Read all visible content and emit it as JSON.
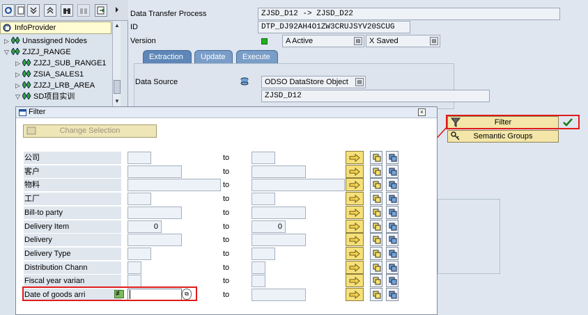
{
  "tree": {
    "header": "InfoProvider",
    "nodes": [
      {
        "label": "Unassigned Nodes",
        "level": 0,
        "expanded": false
      },
      {
        "label": "ZJZJ_RANGE",
        "level": 0,
        "expanded": true
      },
      {
        "label": "ZJZJ_SUB_RANGE1",
        "level": 1,
        "expanded": false
      },
      {
        "label": "ZSIA_SALES1",
        "level": 1,
        "expanded": false
      },
      {
        "label": "ZJZJ_LRB_AREA",
        "level": 1,
        "expanded": false
      },
      {
        "label": "SD项目实训",
        "level": 1,
        "expanded": true
      }
    ]
  },
  "header": {
    "dtp_label": "Data Transfer Process",
    "dtp_value": "ZJSD_D12 -> ZJSD_D22",
    "id_label": "ID",
    "id_value": "DTP_DJ92AH4O1ZW3CRUJSYV20SCUG",
    "version_label": "Version",
    "version_active": "A Active",
    "version_saved": "X Saved"
  },
  "tabs": [
    "Extraction",
    "Update",
    "Execute"
  ],
  "extraction": {
    "datasource_label": "Data Source",
    "datasource_type": "ODSO DataStore Object",
    "datasource_name": "ZJSD_D12"
  },
  "popup_buttons": {
    "filter": "Filter",
    "semantic_groups": "Semantic Groups"
  },
  "dialog": {
    "title": "Filter",
    "change_selection": "Change Selection",
    "to_label": "to",
    "rows": [
      {
        "label": "公司",
        "from": "",
        "to": ""
      },
      {
        "label": "客户",
        "from": "",
        "to": ""
      },
      {
        "label": "物料",
        "from": "",
        "to": ""
      },
      {
        "label": "工厂",
        "from": "",
        "to": ""
      },
      {
        "label": "Bill-to party",
        "from": "",
        "to": ""
      },
      {
        "label": "Delivery Item",
        "from": "0",
        "to": "0"
      },
      {
        "label": "Delivery",
        "from": "",
        "to": ""
      },
      {
        "label": "Delivery Type",
        "from": "",
        "to": ""
      },
      {
        "label": "Distribution Chann",
        "from": "",
        "to": ""
      },
      {
        "label": "Fiscal year varian",
        "from": "",
        "to": ""
      },
      {
        "label": "Date of goods arri",
        "from": "",
        "to": ""
      }
    ]
  },
  "colors": {
    "tab_blue": "#5e87b8",
    "highlight_red": "#e01a1a",
    "button_yellow": "#f5e07a",
    "tree_header_bg": "#fffbd2"
  }
}
